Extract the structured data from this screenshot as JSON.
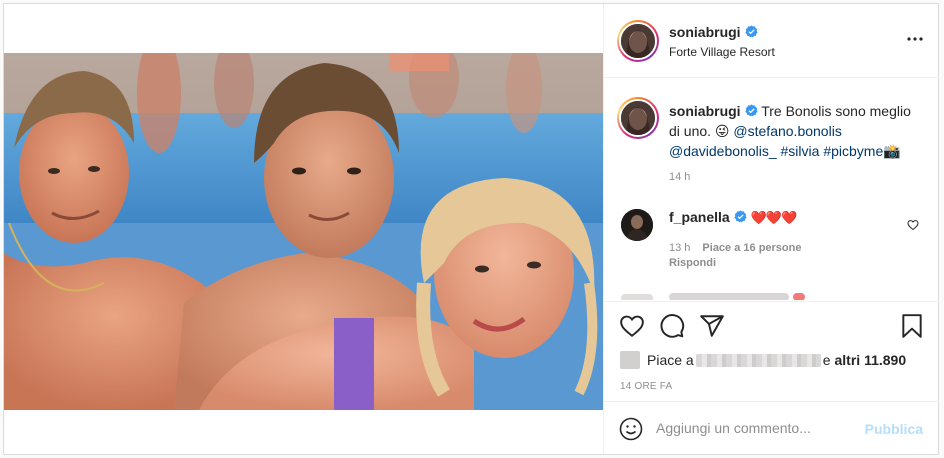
{
  "post": {
    "author": {
      "username": "soniabrugi",
      "verified": true,
      "location": "Forte Village Resort"
    },
    "more_icon": "more-horizontal-icon",
    "caption": {
      "username": "soniabrugi",
      "text": "Tre Bonolis sono meglio di uno. 😜 ",
      "mention1": "@stefano.bonolis",
      "mention2": "@davidebonolis_",
      "hashtag1": "#silvia",
      "hashtag2": "#picbyme📸",
      "time": "14 h"
    },
    "comments": [
      {
        "username": "f_panella",
        "verified": true,
        "text": "❤️❤️❤️",
        "time": "13 h",
        "likes_text": "Piace a 16 persone",
        "reply_label": "Rispondi"
      }
    ],
    "actions": {
      "like_icon": "heart-icon",
      "comment_icon": "comment-icon",
      "share_icon": "paper-plane-icon",
      "save_icon": "bookmark-icon"
    },
    "likes": {
      "prefix": "Piace a",
      "suffix": "e",
      "others": "altri 11.890"
    },
    "timestamp": "14 ORE FA",
    "add_comment": {
      "placeholder": "Aggiungi un commento...",
      "publish_label": "Pubblica",
      "emoji_icon": "smiley-icon"
    }
  },
  "colors": {
    "link": "#00376b",
    "verified": "#3897f0",
    "publish_disabled": "#b2dffc",
    "muted": "#8e8e8e"
  }
}
